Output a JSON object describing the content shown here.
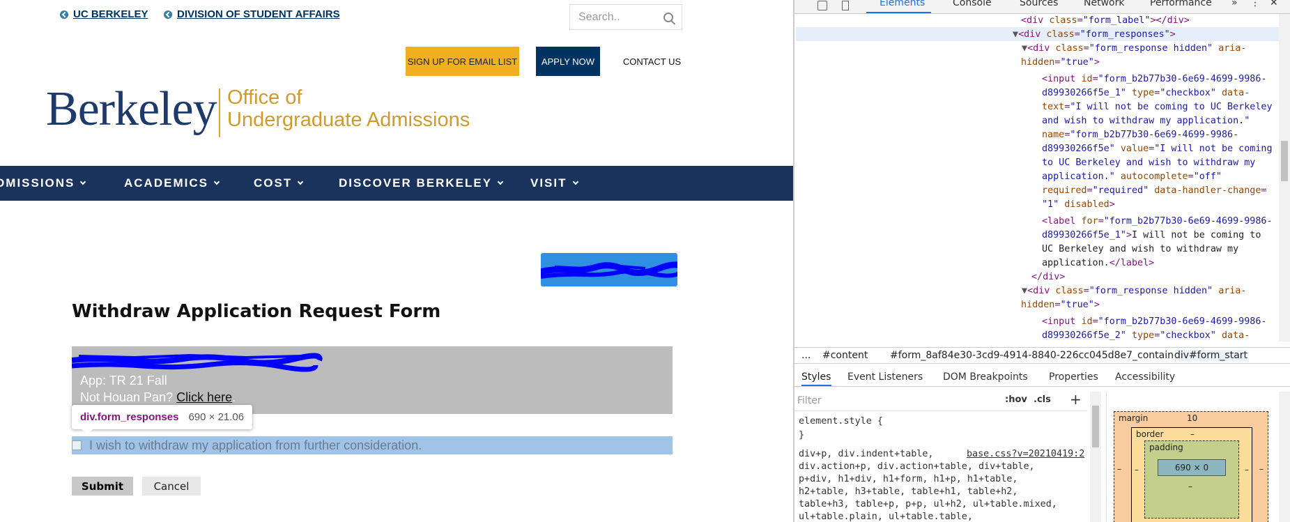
{
  "site": {
    "top_links": [
      "UC BERKELEY",
      "DIVISION OF STUDENT AFFAIRS"
    ],
    "search_placeholder": "Search..",
    "buttons": {
      "email": "SIGN UP FOR EMAIL LIST",
      "apply": "APPLY NOW",
      "contact": "CONTACT US"
    },
    "logo": {
      "wordmark": "Berkeley",
      "office_line1": "Office of",
      "office_line2": "Undergraduate Admissions"
    },
    "nav": [
      "DMISSIONS",
      "ACADEMICS",
      "COST",
      "DISCOVER BERKELEY",
      "VISIT"
    ],
    "form": {
      "title": "Withdraw Application Request Form",
      "app_line": "App: TR 21 Fall",
      "not_user": "Not Houan Pan?",
      "click_here": "Click here",
      "click_suffix": ".",
      "checkbox_label": "I wish to withdraw my application from further consideration.",
      "submit": "Submit",
      "cancel": "Cancel"
    },
    "tooltip": {
      "selector": "div.form_responses",
      "size": "690 × 21.06"
    },
    "colors": {
      "navy": "#19335c",
      "gold": "#f0b020",
      "redaction": "#0000ff"
    }
  },
  "devtools": {
    "tabs": [
      "Elements",
      "Console",
      "Sources",
      "Network",
      "Performance",
      "»"
    ],
    "active_tab": "Elements",
    "breadcrumbs": [
      "...",
      "#content",
      "#form_8af84e30-3cd9-4914-8840-226cc045d8e7_container",
      "div#form_start"
    ],
    "sub_tabs": [
      "Styles",
      "Event Listeners",
      "DOM Breakpoints",
      "Properties",
      "Accessibility"
    ],
    "filter_placeholder": "Filter",
    "hov": ":hov",
    "cls": ".cls",
    "plus": "+",
    "styles_lines": [
      "element.style {",
      "}",
      "div+p, div.indent+table,",
      "div.action+p, div.action+table, div+table,",
      "p+div, h1+div, h1+form, h1+p, h1+table,",
      "h2+table, h3+table, table+h1, table+h2,",
      "table+h3, table+p, p+p, ul+h2, ul+table.mixed,",
      "ul+table.plain, ul+table.table,"
    ],
    "styles_link": "base.css?v=20210419:2",
    "box_model": {
      "margin_label": "margin",
      "margin_top": "10",
      "border_label": "border",
      "padding_label": "padding",
      "dash": "–",
      "content": "690 × 0"
    }
  }
}
